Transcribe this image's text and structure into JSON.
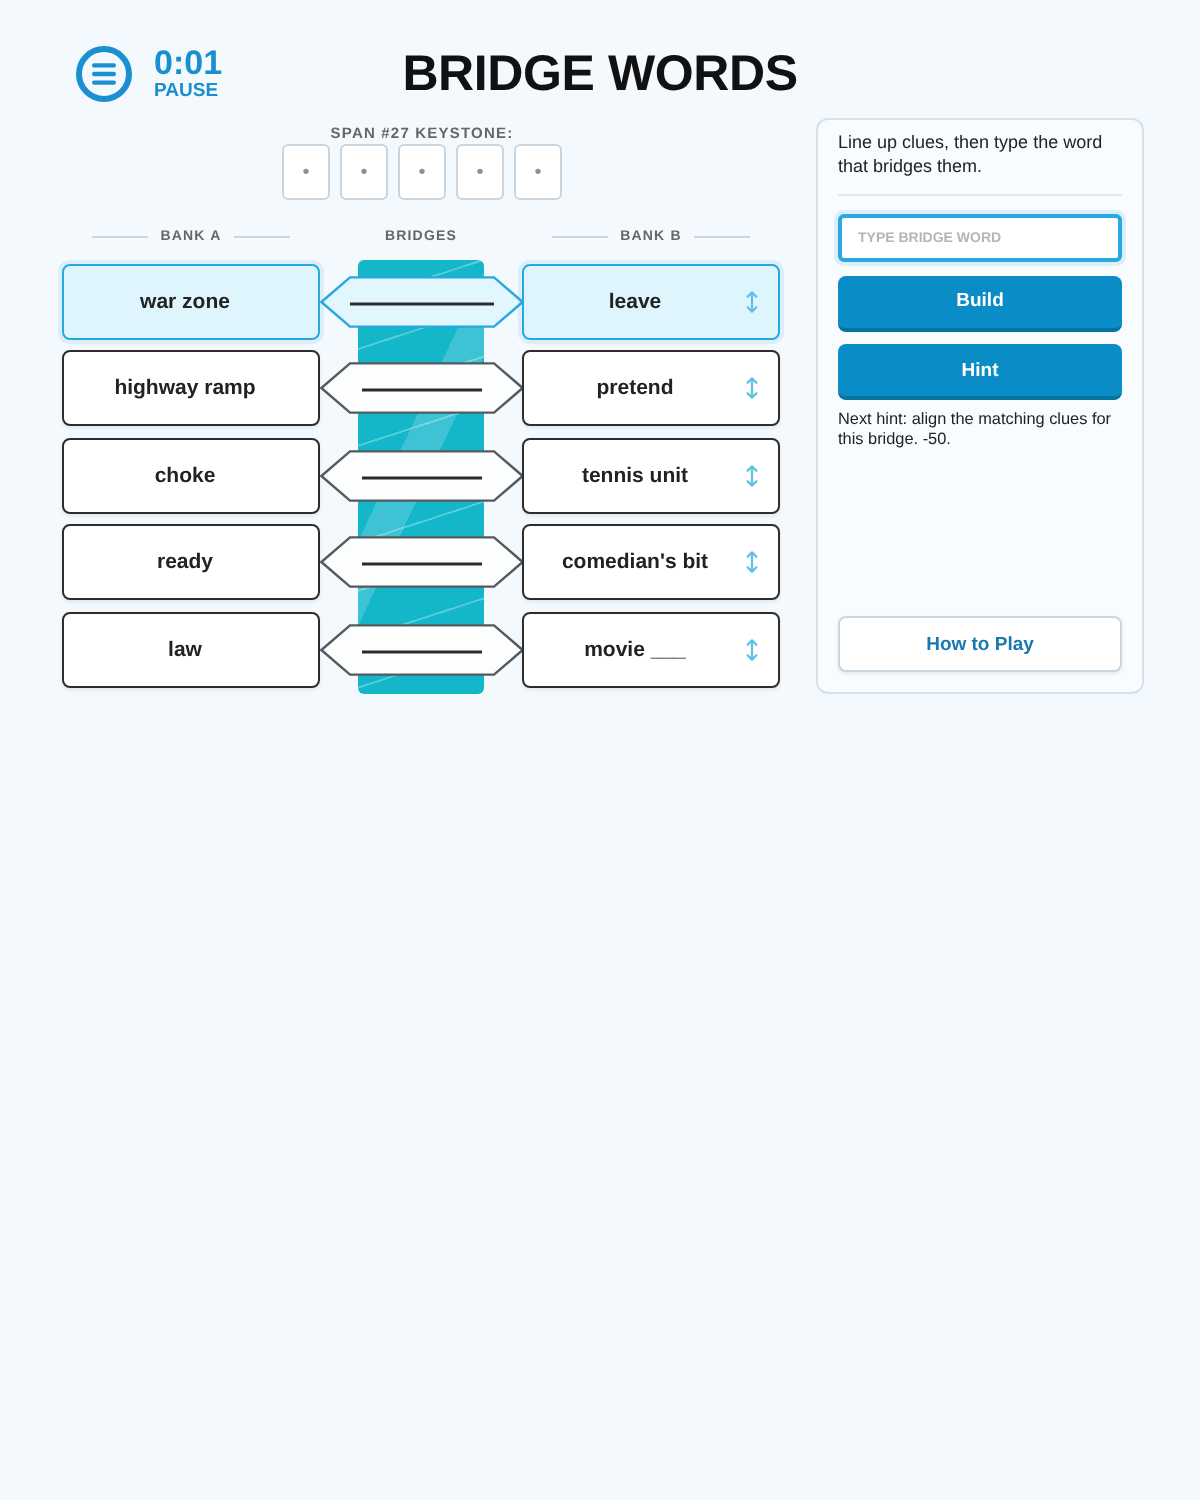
{
  "header": {
    "time": "0:01",
    "pause_label": "PAUSE"
  },
  "title": "BRIDGE WORDS",
  "keystone": {
    "label": "SPAN #27 KEYSTONE:",
    "slots": [
      "•",
      "•",
      "•",
      "•",
      "•"
    ]
  },
  "columns": {
    "bank_a": "BANK A",
    "bridges": "BRIDGES",
    "bank_b": "BANK B"
  },
  "rows": [
    {
      "left": "war zone",
      "right": "leave",
      "selected": true
    },
    {
      "left": "highway ramp",
      "right": "pretend",
      "selected": false
    },
    {
      "left": "choke",
      "right": "tennis unit",
      "selected": false
    },
    {
      "left": "ready",
      "right": "comedian's bit",
      "selected": false
    },
    {
      "left": "law",
      "right": "movie ___",
      "selected": false
    }
  ],
  "panel": {
    "instructions": "Line up clues, then type the word that bridges them.",
    "input": {
      "placeholder": "TYPE BRIDGE WORD"
    },
    "buttons": [
      {
        "label": "Build",
        "kind": "primary"
      },
      {
        "label": "Hint",
        "kind": "primary"
      }
    ],
    "hint_text": "Next hint: align the matching clues for this bridge. -50.",
    "help_button": "How to Play"
  }
}
